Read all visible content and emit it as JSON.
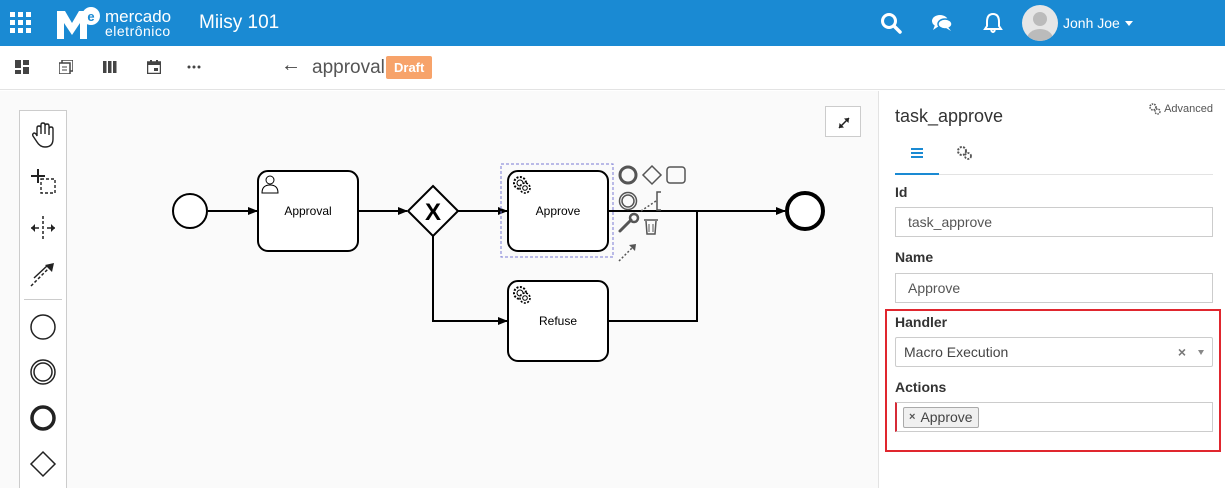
{
  "header": {
    "logo_line1": "mercado",
    "logo_line2": "eletrônico",
    "logo_mark_letter": "e",
    "app_title": "Miisy 101",
    "user_name": "Jonh Joe",
    "icons": [
      "apps-grid-icon",
      "search-icon",
      "chat-icon",
      "bell-icon",
      "avatar-icon",
      "caret-down-icon"
    ]
  },
  "toolbar": {
    "icons": [
      "dashboard-icon",
      "documents-icon",
      "columns-icon",
      "calendar-icon",
      "more-icon"
    ],
    "back_icon": "←",
    "title": "approval",
    "badge": "Draft"
  },
  "diagram": {
    "palette_tools": [
      "hand-tool-icon",
      "lasso-tool-icon",
      "space-tool-icon",
      "connect-tool-icon",
      "start-event-icon",
      "intermediate-event-icon",
      "end-event-icon",
      "gateway-icon"
    ],
    "nodes": {
      "approval": "Approval",
      "approve": "Approve",
      "refuse": "Refuse",
      "gateway_mark": "X"
    }
  },
  "properties": {
    "title": "task_approve",
    "advanced_label": "Advanced",
    "tabs": [
      "list-icon",
      "gears-icon"
    ],
    "id_label": "Id",
    "id_value": "task_approve",
    "name_label": "Name",
    "name_value": "Approve",
    "handler_label": "Handler",
    "handler_value": "Macro Execution",
    "handler_clear": "×",
    "actions_label": "Actions",
    "action_tag": "Approve",
    "action_tag_remove": "×"
  },
  "colors": {
    "header_bg": "#1a8ad3",
    "badge_bg": "#f7a36a",
    "highlight_border": "#e0262e",
    "selection_dash": "#7b7bd4"
  }
}
